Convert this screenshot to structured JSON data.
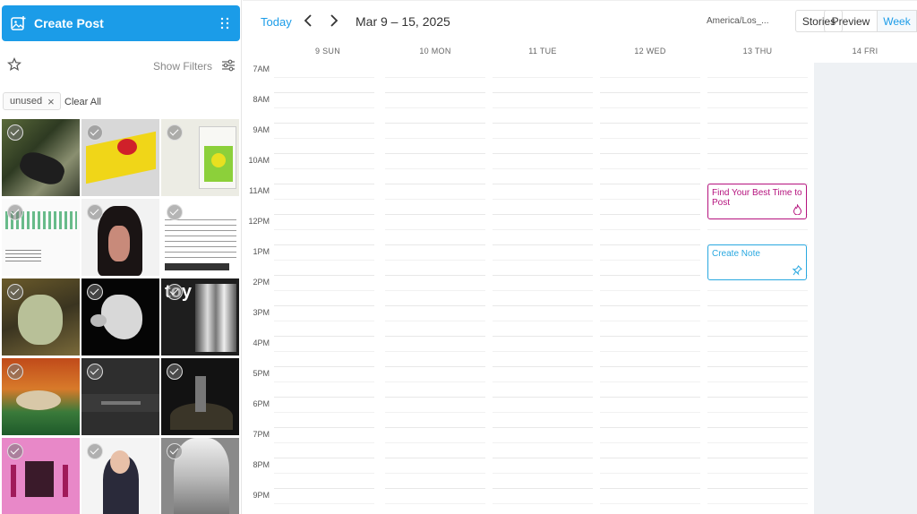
{
  "sidebar": {
    "create_post_label": "Create Post",
    "show_filters_label": "Show Filters",
    "chip_label": "unused",
    "chip_close": "×",
    "clear_all_label": "Clear All"
  },
  "header": {
    "today_label": "Today",
    "date_range": "Mar 9 – 15, 2025",
    "timezone": "America/Los_...",
    "stories_label": "Stories",
    "preview_label": "Preview",
    "week_label": "Week"
  },
  "calendar": {
    "days": [
      "9 SUN",
      "10 MON",
      "11 TUE",
      "12 WED",
      "13 THU",
      "14 FRI"
    ],
    "hours": [
      "7AM",
      "8AM",
      "9AM",
      "10AM",
      "11AM",
      "12PM",
      "1PM",
      "2PM",
      "3PM",
      "4PM",
      "5PM",
      "6PM",
      "7PM",
      "8PM",
      "9PM"
    ],
    "events": {
      "best_time": "Find Your Best Time to Post",
      "create_note": "Create Note"
    }
  },
  "colors": {
    "primary": "#1b9ce8",
    "best_time_border": "#b5127d",
    "note_border": "#29a8e0"
  },
  "icons": [
    "image-plus-icon",
    "grip-icon",
    "star-icon",
    "sliders-icon",
    "close-icon",
    "chevron-left-icon",
    "chevron-right-icon",
    "flame-icon",
    "pin-icon",
    "check-icon"
  ]
}
